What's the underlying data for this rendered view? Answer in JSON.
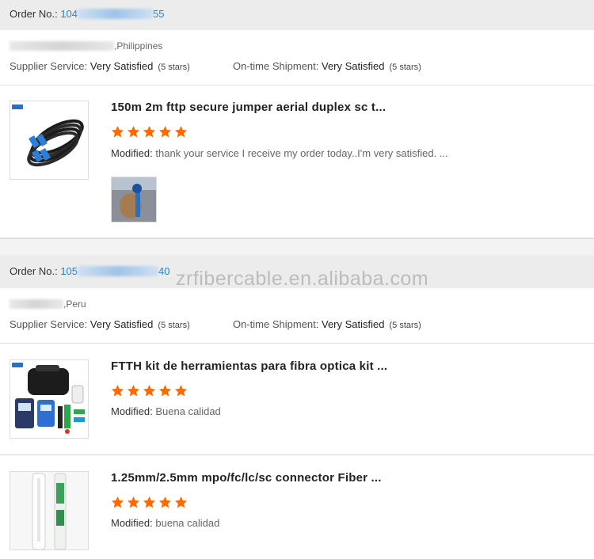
{
  "orders": [
    {
      "order_label": "Order No.:",
      "order_prefix": "104",
      "order_suffix": "55",
      "location": ",Philippines",
      "supplier_label": "Supplier Service:",
      "supplier_value": "Very Satisfied",
      "supplier_stars": "(5 stars)",
      "shipment_label": "On-time Shipment:",
      "shipment_value": "Very Satisfied",
      "shipment_stars": "(5 stars)",
      "items": [
        {
          "title": "150m 2m fttp secure jumper aerial duplex sc t...",
          "rating": 5,
          "modified_label": "Modified:",
          "review": "thank your service I receive my order today..I'm very satisfied. ..."
        }
      ]
    },
    {
      "order_label": "Order No.:",
      "order_prefix": "105",
      "order_suffix": "40",
      "location": ",Peru",
      "supplier_label": "Supplier Service:",
      "supplier_value": "Very Satisfied",
      "supplier_stars": "(5 stars)",
      "shipment_label": "On-time Shipment:",
      "shipment_value": "Very Satisfied",
      "shipment_stars": "(5 stars)",
      "items": [
        {
          "title": "FTTH kit de herramientas para fibra optica kit ...",
          "rating": 5,
          "modified_label": "Modified:",
          "review": "Buena calidad"
        },
        {
          "title": "1.25mm/2.5mm mpo/fc/lc/sc connector Fiber ...",
          "rating": 5,
          "modified_label": "Modified:",
          "review": "buena calidad"
        }
      ]
    }
  ],
  "watermark": "zrfibercable.en.alibaba.com",
  "colors": {
    "star": "#ff6a00",
    "order_number": "#2a7fc9",
    "header_bg": "#ececec"
  }
}
